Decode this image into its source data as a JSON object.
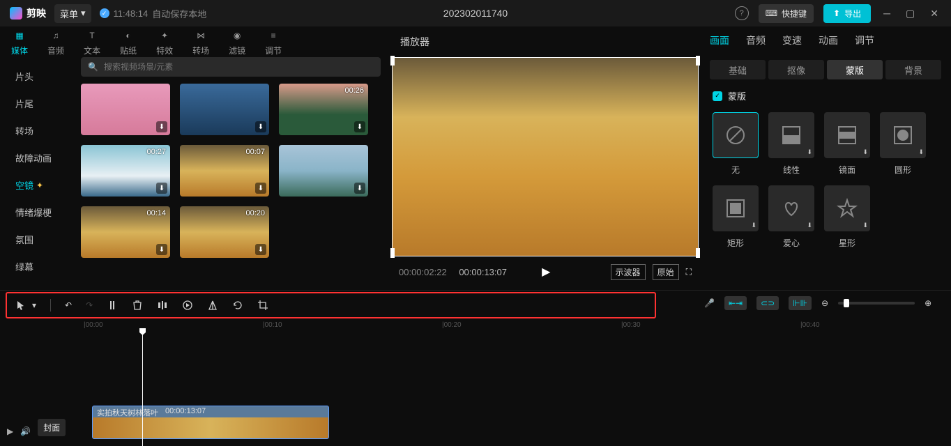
{
  "titlebar": {
    "app_name": "剪映",
    "menu_label": "菜单",
    "autosave_time": "11:48:14",
    "autosave_text": "自动保存本地",
    "project_name": "202302011740",
    "shortcut_label": "快捷键",
    "export_label": "导出"
  },
  "top_tabs": [
    {
      "label": "媒体",
      "active": true
    },
    {
      "label": "音频",
      "active": false
    },
    {
      "label": "文本",
      "active": false
    },
    {
      "label": "贴纸",
      "active": false
    },
    {
      "label": "特效",
      "active": false
    },
    {
      "label": "转场",
      "active": false
    },
    {
      "label": "滤镜",
      "active": false
    },
    {
      "label": "调节",
      "active": false
    }
  ],
  "categories": [
    {
      "label": "片头",
      "active": false
    },
    {
      "label": "片尾",
      "active": false
    },
    {
      "label": "转场",
      "active": false
    },
    {
      "label": "故障动画",
      "active": false
    },
    {
      "label": "空镜",
      "active": true,
      "star": true
    },
    {
      "label": "情绪爆梗",
      "active": false
    },
    {
      "label": "氛围",
      "active": false
    },
    {
      "label": "绿幕",
      "active": false
    }
  ],
  "search": {
    "placeholder": "搜索视频场景/元素"
  },
  "thumbs": [
    {
      "duration": "",
      "bg": "linear-gradient(to bottom,#e89abb 0%,#d67a9a 100%)"
    },
    {
      "duration": "",
      "bg": "linear-gradient(to bottom,#3a6a9a 0%,#1a3a5a 100%)"
    },
    {
      "duration": "00:26",
      "bg": "linear-gradient(to bottom,#d89a8a 0%,#2a5a3a 60%)"
    },
    {
      "duration": "00:27",
      "bg": "linear-gradient(to bottom,#8ac4d4 0%,#e8f0f4 60%,#3a6a8a 100%)"
    },
    {
      "duration": "00:07",
      "bg": "linear-gradient(to bottom,#6b5a3a 0%,#d8b35a 50%,#b87a2a 100%)"
    },
    {
      "duration": "",
      "bg": "linear-gradient(to bottom,#a8c4d8 0%,#8ab4c8 50%,#3a6a5a 100%)"
    },
    {
      "duration": "00:14",
      "bg": "linear-gradient(to bottom,#6b5a3a 0%,#d8b35a 50%,#b87a2a 100%)"
    },
    {
      "duration": "00:20",
      "bg": "linear-gradient(to bottom,#6b5a3a 0%,#d8b35a 50%,#b87a2a 100%)"
    }
  ],
  "player": {
    "title": "播放器",
    "current_time": "00:00:02:22",
    "total_time": "00:00:13:07",
    "waveform_label": "示波器",
    "original_label": "原始"
  },
  "right": {
    "tabs": [
      "画面",
      "音频",
      "变速",
      "动画",
      "调节"
    ],
    "active_tab": 0,
    "subtabs": [
      "基础",
      "抠像",
      "蒙版",
      "背景"
    ],
    "active_subtab": 2,
    "section_label": "蒙版",
    "masks": [
      {
        "label": "无",
        "active": true,
        "icon": "none",
        "dl": false
      },
      {
        "label": "线性",
        "active": false,
        "icon": "linear",
        "dl": true
      },
      {
        "label": "镜面",
        "active": false,
        "icon": "mirror",
        "dl": true
      },
      {
        "label": "圆形",
        "active": false,
        "icon": "circle",
        "dl": true
      },
      {
        "label": "矩形",
        "active": false,
        "icon": "rect",
        "dl": true
      },
      {
        "label": "爱心",
        "active": false,
        "icon": "heart",
        "dl": true
      },
      {
        "label": "星形",
        "active": false,
        "icon": "star",
        "dl": true
      }
    ]
  },
  "timeline": {
    "cover_label": "封面",
    "clip_name": "实拍秋天树林落叶",
    "clip_duration": "00:00:13:07",
    "ruler_ticks": [
      "00:00",
      "00:10",
      "00:20",
      "00:30",
      "00:40"
    ]
  }
}
